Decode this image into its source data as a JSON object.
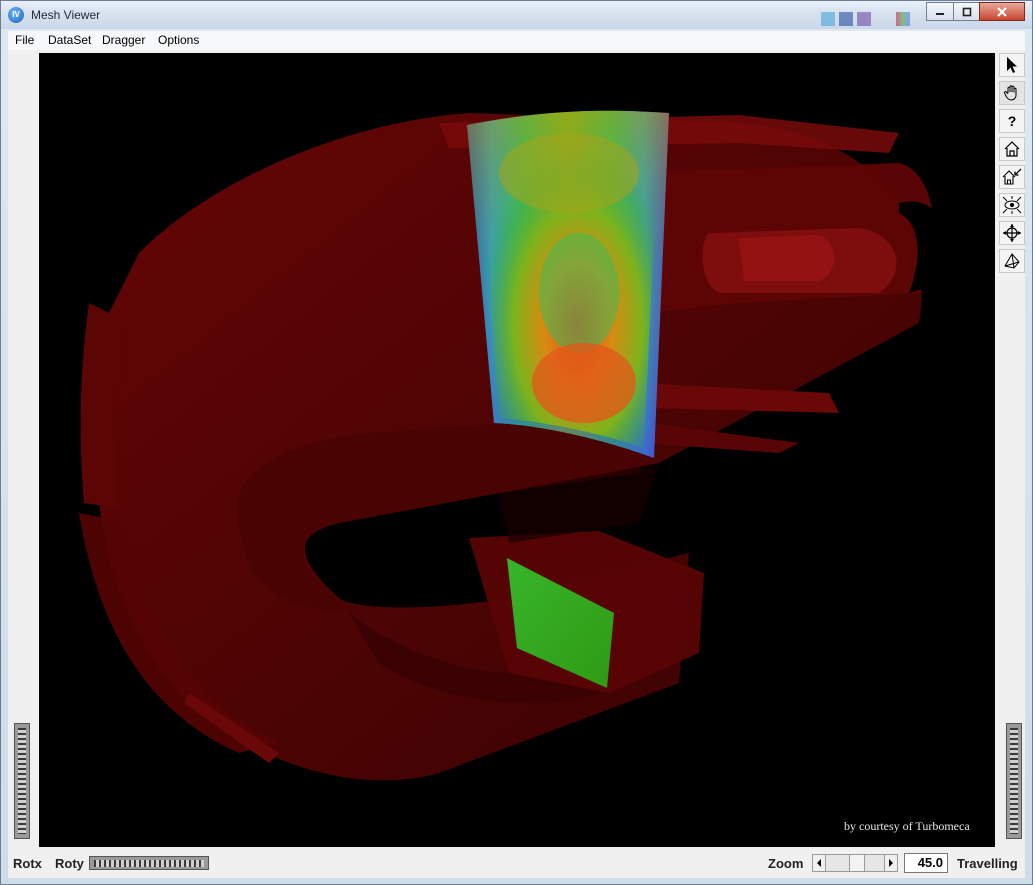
{
  "window": {
    "title": "Mesh Viewer"
  },
  "menu": {
    "file": "File",
    "dataset": "DataSet",
    "dragger": "Dragger",
    "options": "Options"
  },
  "viewer": {
    "courtesy": "by courtesy of Turbomeca",
    "background": "#000000",
    "model_color": "#5a0000"
  },
  "toolbar": {
    "items": [
      "select-arrow-icon",
      "hand-icon",
      "help-icon",
      "home-icon",
      "set-home-icon",
      "view-all-icon",
      "seek-icon",
      "perspective-icon"
    ],
    "help_glyph": "?"
  },
  "bottom": {
    "rotx_label": "Rotx",
    "roty_label": "Roty",
    "zoom_label": "Zoom",
    "zoom_value": "45.0",
    "travel_label": "Travelling"
  }
}
